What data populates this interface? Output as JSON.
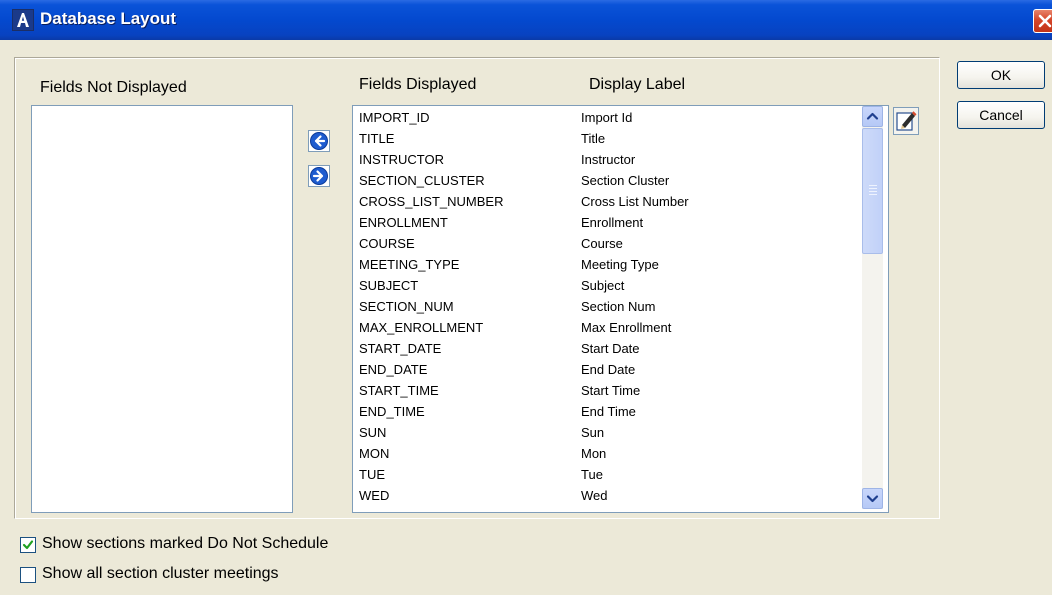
{
  "window": {
    "title": "Database Layout",
    "app_icon_letter": "A"
  },
  "labels": {
    "fields_not_displayed": "Fields Not Displayed",
    "fields_displayed": "Fields Displayed",
    "display_label": "Display Label"
  },
  "buttons": {
    "ok": "OK",
    "cancel": "Cancel"
  },
  "fields": [
    {
      "field": "IMPORT_ID",
      "label": "Import Id"
    },
    {
      "field": "TITLE",
      "label": "Title"
    },
    {
      "field": "INSTRUCTOR",
      "label": "Instructor"
    },
    {
      "field": "SECTION_CLUSTER",
      "label": "Section Cluster"
    },
    {
      "field": "CROSS_LIST_NUMBER",
      "label": "Cross List Number"
    },
    {
      "field": "ENROLLMENT",
      "label": "Enrollment"
    },
    {
      "field": "COURSE",
      "label": "Course"
    },
    {
      "field": "MEETING_TYPE",
      "label": "Meeting Type"
    },
    {
      "field": "SUBJECT",
      "label": "Subject"
    },
    {
      "field": "SECTION_NUM",
      "label": "Section Num"
    },
    {
      "field": "MAX_ENROLLMENT",
      "label": "Max Enrollment"
    },
    {
      "field": "START_DATE",
      "label": "Start Date"
    },
    {
      "field": "END_DATE",
      "label": "End Date"
    },
    {
      "field": "START_TIME",
      "label": "Start Time"
    },
    {
      "field": "END_TIME",
      "label": "End Time"
    },
    {
      "field": "SUN",
      "label": "Sun"
    },
    {
      "field": "MON",
      "label": "Mon"
    },
    {
      "field": "TUE",
      "label": "Tue"
    },
    {
      "field": "WED",
      "label": "Wed"
    }
  ],
  "options": {
    "show_do_not_schedule": {
      "label": "Show sections marked Do Not Schedule",
      "checked": true
    },
    "show_all_cluster_meetings": {
      "label": "Show all section cluster meetings",
      "checked": false
    }
  },
  "colors": {
    "titlebar": "#0449cf",
    "dialog_bg": "#ece9d8",
    "arrow_button": "#1e5ccf",
    "close_button": "#d5462a"
  },
  "icons": {
    "move_left": "arrow-left-icon",
    "move_right": "arrow-right-icon",
    "edit": "pencil-edit-icon",
    "close": "close-icon"
  }
}
